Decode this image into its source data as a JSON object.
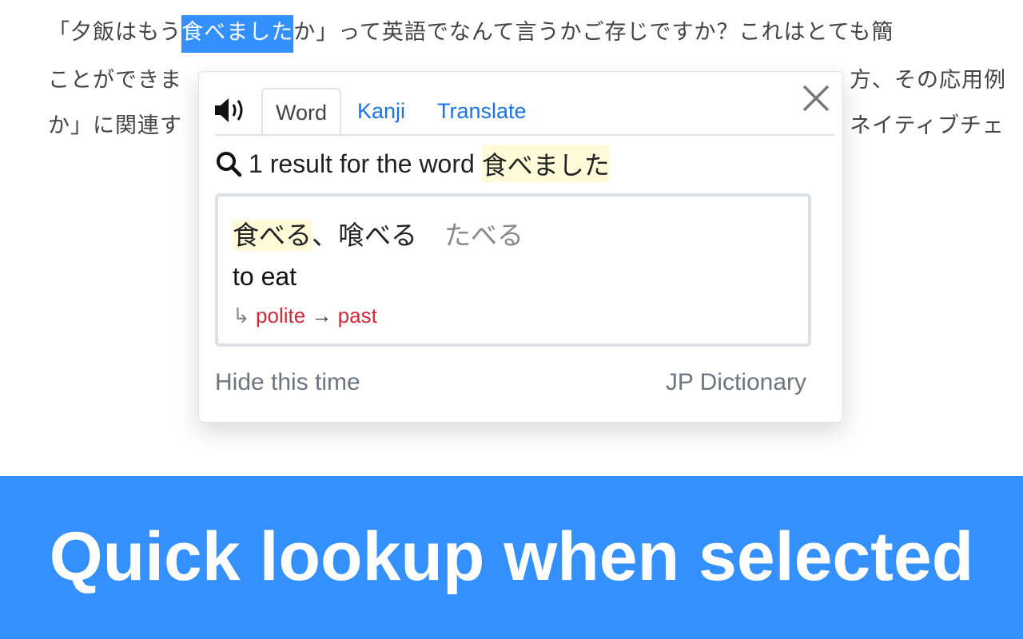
{
  "article": {
    "line1_before": "「夕飯はもう",
    "line1_selected": "食べました",
    "line1_after": "か」って英語でなんて言うかご存じですか？これはとても簡",
    "line2_left": "ことができま",
    "line2_right": "方、その応用例",
    "line3_left": "か」に関連す",
    "line3_right": "ネイティブチェ"
  },
  "popup": {
    "tabs": [
      {
        "label": "Word",
        "active": true
      },
      {
        "label": "Kanji",
        "active": false
      },
      {
        "label": "Translate",
        "active": false
      }
    ],
    "result_text": "1 result for the word",
    "query": "食べました",
    "entry": {
      "headword": "食べる",
      "alternate": "、喰べる",
      "reading": "たべる",
      "meaning": "to eat",
      "inflection_arrow": "↳",
      "inflection_1": "polite",
      "inflection_sep": "→",
      "inflection_2": "past"
    },
    "hide_label": "Hide this time",
    "brand_label": "JP Dictionary"
  },
  "banner": {
    "text": "Quick lookup when selected"
  },
  "colors": {
    "selection": "#3390ff",
    "banner": "#3390fd",
    "tab_link": "#1a73e8",
    "inflection": "#d0293a",
    "highlight": "#fffbd9"
  }
}
